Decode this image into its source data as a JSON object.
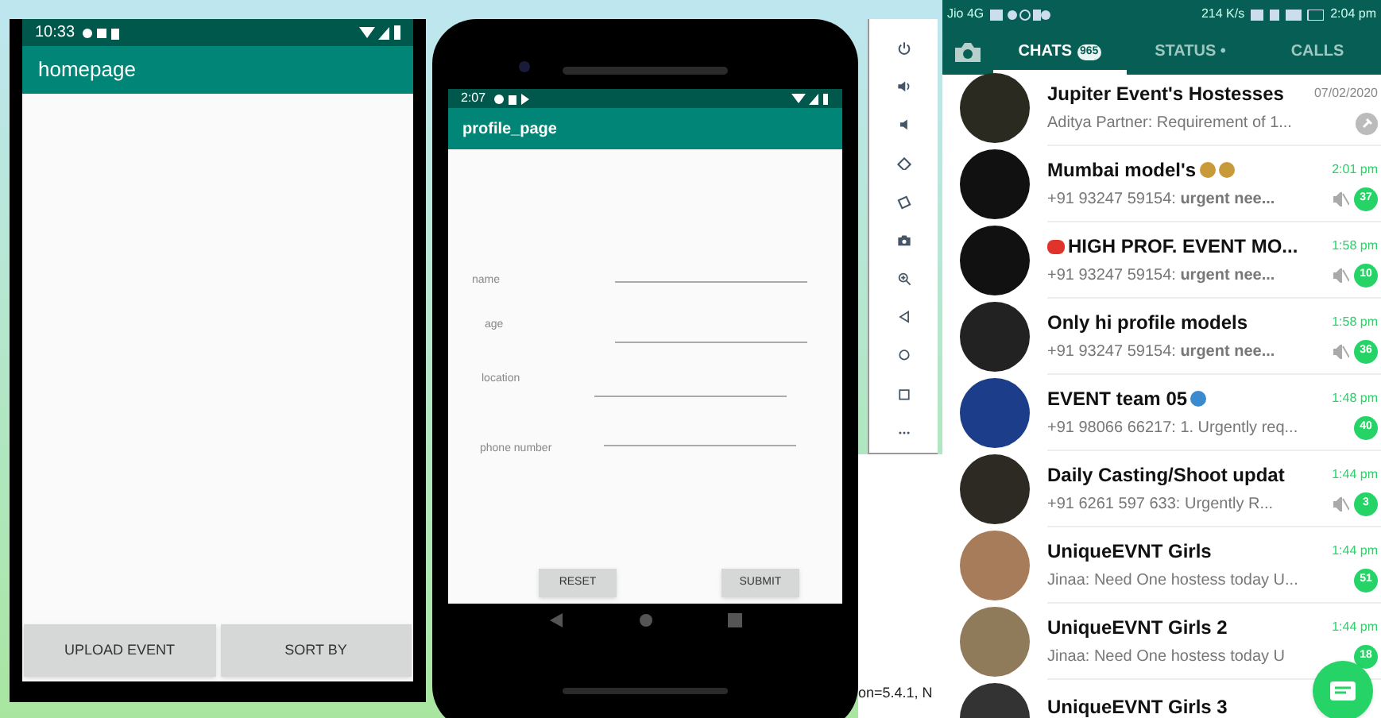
{
  "homepage_screen": {
    "status_time": "10:33",
    "title": "homepage",
    "buttons": [
      {
        "label": "UPLOAD EVENT"
      },
      {
        "label": "SORT BY"
      }
    ]
  },
  "profile_screen": {
    "status_time": "2:07",
    "title": "profile_page",
    "fields": [
      {
        "label": "name"
      },
      {
        "label": "age"
      },
      {
        "label": "location"
      },
      {
        "label": "phone number"
      }
    ],
    "buttons": [
      {
        "label": "RESET"
      },
      {
        "label": "SUBMIT"
      }
    ]
  },
  "emulator_status_text": "on=5.4.1, N",
  "chat_screen": {
    "status_left": "Jio 4G",
    "status_right": "214 K/s",
    "status_time": "2:04 pm",
    "tabs": [
      {
        "label": "CHATS",
        "badge": "965",
        "selected": true
      },
      {
        "label": "STATUS •",
        "selected": false
      },
      {
        "label": "CALLS",
        "selected": false
      }
    ],
    "chats": [
      {
        "name": "Jupiter Event's Hostesses",
        "preview": "Aditya Partner: Requirement of 1...",
        "time": "07/02/2020",
        "pinned": true,
        "muted": false
      },
      {
        "name": "Mumbai model's",
        "emojis": [
          {
            "kind": "face"
          },
          {
            "kind": "face"
          }
        ],
        "preview": "+91 93247 59154: **urgent nee...**",
        "time": "2:01 pm",
        "unread": "37",
        "muted": true,
        "pinned": false
      },
      {
        "name": "HIGH PROF. EVENT MO...",
        "lead_emojis": [
          {
            "kind": "animal"
          }
        ],
        "preview": "+91 93247 59154: **urgent nee...**",
        "time": "1:58 pm",
        "unread": "10",
        "muted": true,
        "pinned": false
      },
      {
        "name": "Only hi profile models",
        "preview": "+91 93247 59154: **urgent nee...**",
        "time": "1:58 pm",
        "unread": "36",
        "muted": true,
        "pinned": false
      },
      {
        "name": "EVENT team 05",
        "emojis": [
          {
            "kind": "globe"
          }
        ],
        "preview": "+91 98066 66217: 1. Urgently req...",
        "time": "1:48 pm",
        "unread": "40",
        "muted": false,
        "pinned": false
      },
      {
        "name": "Daily Casting/Shoot updat",
        "preview": "+91 6261 597 633: Urgently  R...",
        "time": "1:44 pm",
        "unread": "3",
        "muted": true,
        "pinned": false
      },
      {
        "name": "UniqueEVNT Girls",
        "preview": "Jinaa: Need One hostess today U...",
        "time": "1:44 pm",
        "unread": "51",
        "muted": false,
        "pinned": false
      },
      {
        "name": "UniqueEVNT Girls 2",
        "preview": "Jinaa: Need One hostess today U",
        "time": "1:44 pm",
        "unread": "18",
        "muted": false,
        "pinned": false
      },
      {
        "name": "UniqueEVNT Girls 3",
        "muted": false,
        "pinned": false
      }
    ]
  }
}
